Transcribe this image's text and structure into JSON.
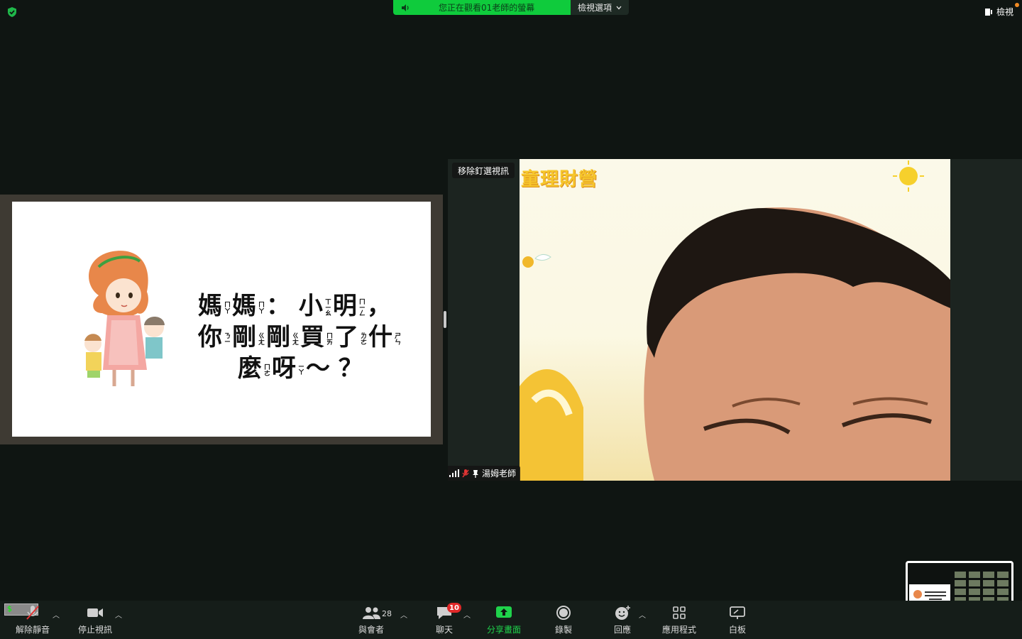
{
  "top": {
    "share_banner_text": "您正在觀看01老師的螢幕",
    "view_options_label": "檢視選項",
    "view_label": "檢視"
  },
  "slide": {
    "line1": [
      "媽",
      "媽",
      "：",
      "小",
      "明",
      "，"
    ],
    "line1_bpmf": [
      "ㄇㄚ",
      "ㄇㄚ",
      "",
      "ㄒㄧㄠ",
      "ㄇㄧㄥ",
      ""
    ],
    "line2": [
      "你",
      "剛",
      "剛",
      "買",
      "了",
      "什"
    ],
    "line2_bpmf": [
      "ㄋㄧ",
      "ㄍㄤ",
      "ㄍㄤ",
      "ㄇㄞ",
      "ㄌㄜ",
      "ㄕㄣ"
    ],
    "line3": [
      "麼",
      "呀",
      "～",
      "？"
    ],
    "line3_bpmf": [
      "ㄇㄜ",
      "ㄧㄚ",
      "",
      ""
    ]
  },
  "video": {
    "unpin_label": "移除釘選視訊",
    "participant_name": "湯姆老師",
    "background_title": "童理財營"
  },
  "toolbar": {
    "unmute_label": "解除靜音",
    "stop_video_label": "停止視訊",
    "participants_label": "與會者",
    "participants_count": "28",
    "chat_label": "聊天",
    "chat_badge": "10",
    "share_label": "分享畫面",
    "record_label": "錄製",
    "reactions_label": "回應",
    "apps_label": "應用程式",
    "whiteboard_label": "白板",
    "money_chip": "$"
  },
  "colors": {
    "green": "#0fcb3c",
    "toolbar_bg": "#151d19",
    "badge_red": "#e02828"
  }
}
